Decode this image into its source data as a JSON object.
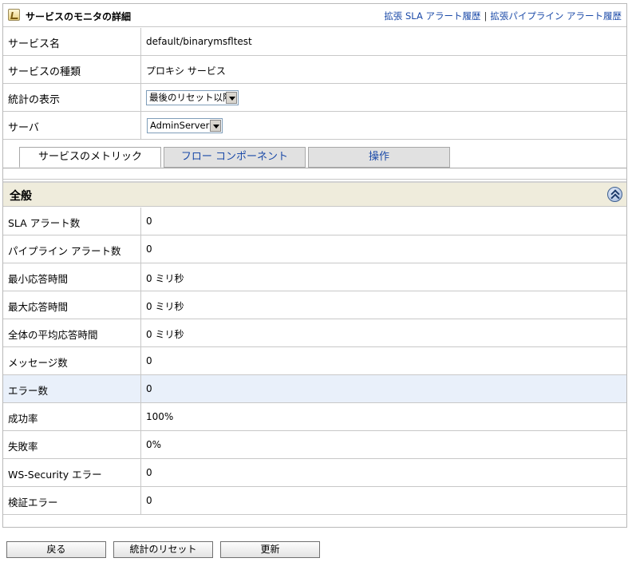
{
  "header": {
    "title": "サービスのモニタの詳細",
    "link_sla": "拡張 SLA アラート履歴",
    "link_separator": "|",
    "link_pipeline": "拡張パイプライン アラート履歴"
  },
  "info": {
    "service_name_label": "サービス名",
    "service_name_value": "default/binarymsfltest",
    "service_type_label": "サービスの種類",
    "service_type_value": "プロキシ サービス",
    "stats_label": "統計の表示",
    "stats_selected": "最後のリセット以降",
    "server_label": "サーバ",
    "server_selected": "AdminServer"
  },
  "tabs": [
    {
      "label": "サービスのメトリック",
      "active": true
    },
    {
      "label": "フロー コンポーネント",
      "active": false
    },
    {
      "label": "操作",
      "active": false
    }
  ],
  "section": {
    "title": "全般"
  },
  "metrics": [
    {
      "label": "SLA アラート数",
      "value": "0"
    },
    {
      "label": "パイプライン アラート数",
      "value": "0"
    },
    {
      "label": "最小応答時間",
      "value": "0 ミリ秒"
    },
    {
      "label": "最大応答時間",
      "value": "0 ミリ秒"
    },
    {
      "label": "全体の平均応答時間",
      "value": "0 ミリ秒"
    },
    {
      "label": "メッセージ数",
      "value": "0"
    },
    {
      "label": "エラー数",
      "value": "0"
    },
    {
      "label": "成功率",
      "value": "100%"
    },
    {
      "label": "失敗率",
      "value": "0%"
    },
    {
      "label": "WS-Security エラー",
      "value": "0"
    },
    {
      "label": "検証エラー",
      "value": "0"
    }
  ],
  "buttons": {
    "back": "戻る",
    "reset_stats": "統計のリセット",
    "refresh": "更新"
  },
  "colors": {
    "link": "#1b4aa8",
    "section_bg": "#efecdc",
    "highlight_row": "#e9f0fa",
    "border": "#c8c8c8"
  }
}
